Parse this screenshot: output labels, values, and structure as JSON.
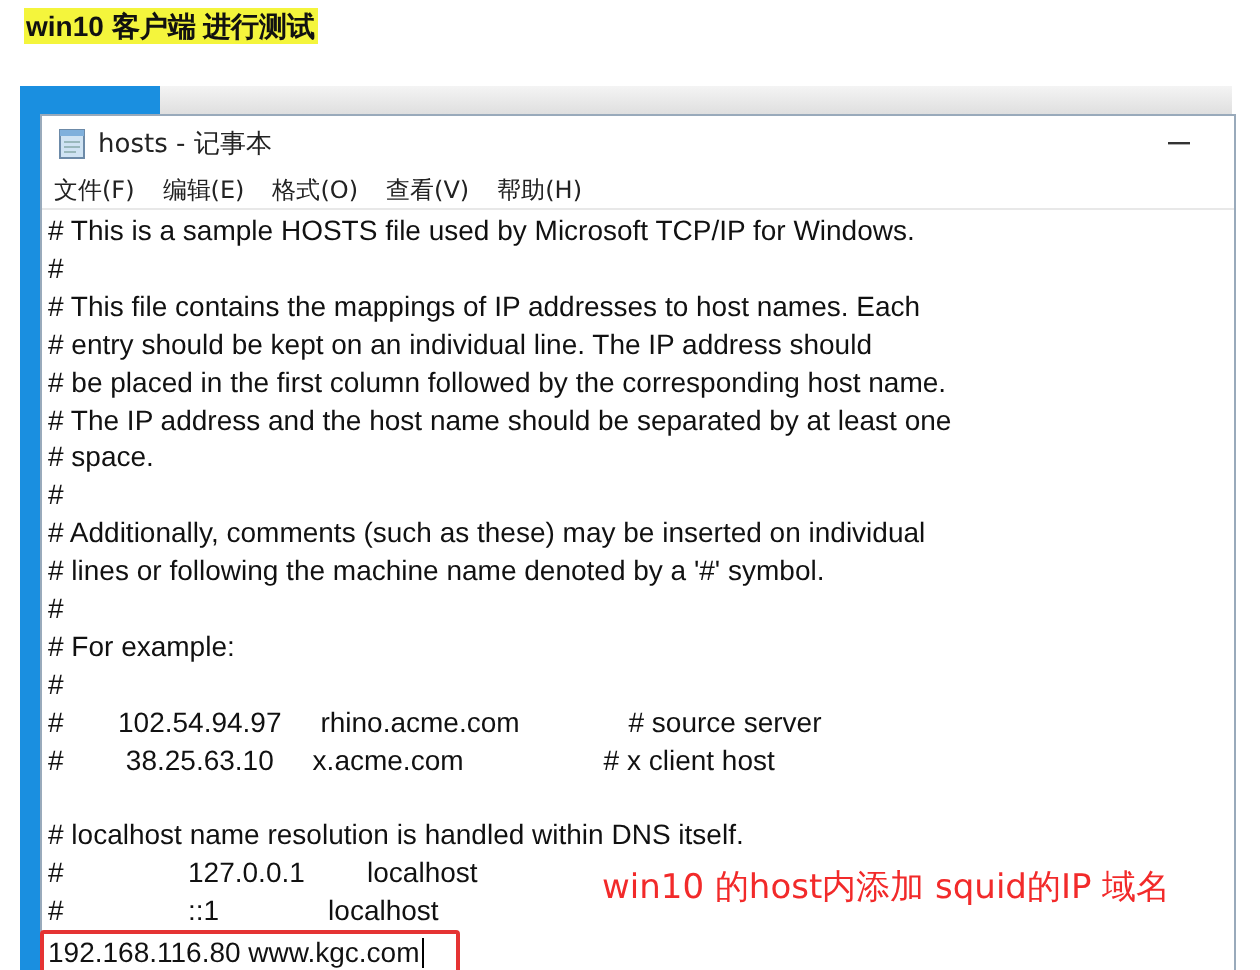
{
  "heading": "win10 客户端 进行测试",
  "window": {
    "title": "hosts - 记事本"
  },
  "menu": [
    "文件(F)",
    "编辑(E)",
    "格式(O)",
    "查看(V)",
    "帮助(H)"
  ],
  "lines": [
    {
      "text": "# This is a sample HOSTS file used by Microsoft TCP/IP for Windows.",
      "blank_before": false,
      "highlighted": false,
      "cursor": false
    },
    {
      "text": "#",
      "blank_before": false,
      "highlighted": false,
      "cursor": false
    },
    {
      "text": "# This file contains the mappings of IP addresses to host names. Each",
      "blank_before": false,
      "highlighted": false,
      "cursor": false
    },
    {
      "text": "# entry should be kept on an individual line. The IP address should",
      "blank_before": false,
      "highlighted": false,
      "cursor": false
    },
    {
      "text": "# be placed in the first column followed by the corresponding host name.",
      "blank_before": false,
      "highlighted": false,
      "cursor": false
    },
    {
      "text": "# The IP address and the host name should be separated by at least one",
      "blank_before": false,
      "highlighted": false,
      "cursor": false
    },
    {
      "text": "# space.",
      "blank_before": false,
      "highlighted": false,
      "cursor": false
    },
    {
      "text": "#",
      "blank_before": false,
      "highlighted": false,
      "cursor": false
    },
    {
      "text": "# Additionally, comments (such as these) may be inserted on individual",
      "blank_before": false,
      "highlighted": false,
      "cursor": false
    },
    {
      "text": "# lines or following the machine name denoted by a '#' symbol.",
      "blank_before": false,
      "highlighted": false,
      "cursor": false
    },
    {
      "text": "#",
      "blank_before": false,
      "highlighted": false,
      "cursor": false
    },
    {
      "text": "# For example:",
      "blank_before": false,
      "highlighted": false,
      "cursor": false
    },
    {
      "text": "#",
      "blank_before": false,
      "highlighted": false,
      "cursor": false
    },
    {
      "text": "#       102.54.94.97     rhino.acme.com              # source server",
      "blank_before": false,
      "highlighted": false,
      "cursor": false
    },
    {
      "text": "#        38.25.63.10     x.acme.com                  # x client host",
      "blank_before": false,
      "highlighted": false,
      "cursor": false
    },
    {
      "text": "# localhost name resolution is handled within DNS itself.",
      "blank_before": true,
      "highlighted": false,
      "cursor": false
    },
    {
      "text": "#                127.0.0.1        localhost",
      "blank_before": false,
      "highlighted": false,
      "cursor": false
    },
    {
      "text": "#                ::1              localhost",
      "blank_before": false,
      "highlighted": false,
      "cursor": false
    },
    {
      "text": "192.168.116.80 www.kgc.com",
      "blank_before": false,
      "highlighted": true,
      "cursor": true
    }
  ],
  "annotation": "win10 的host内添加 squid的IP 域名"
}
